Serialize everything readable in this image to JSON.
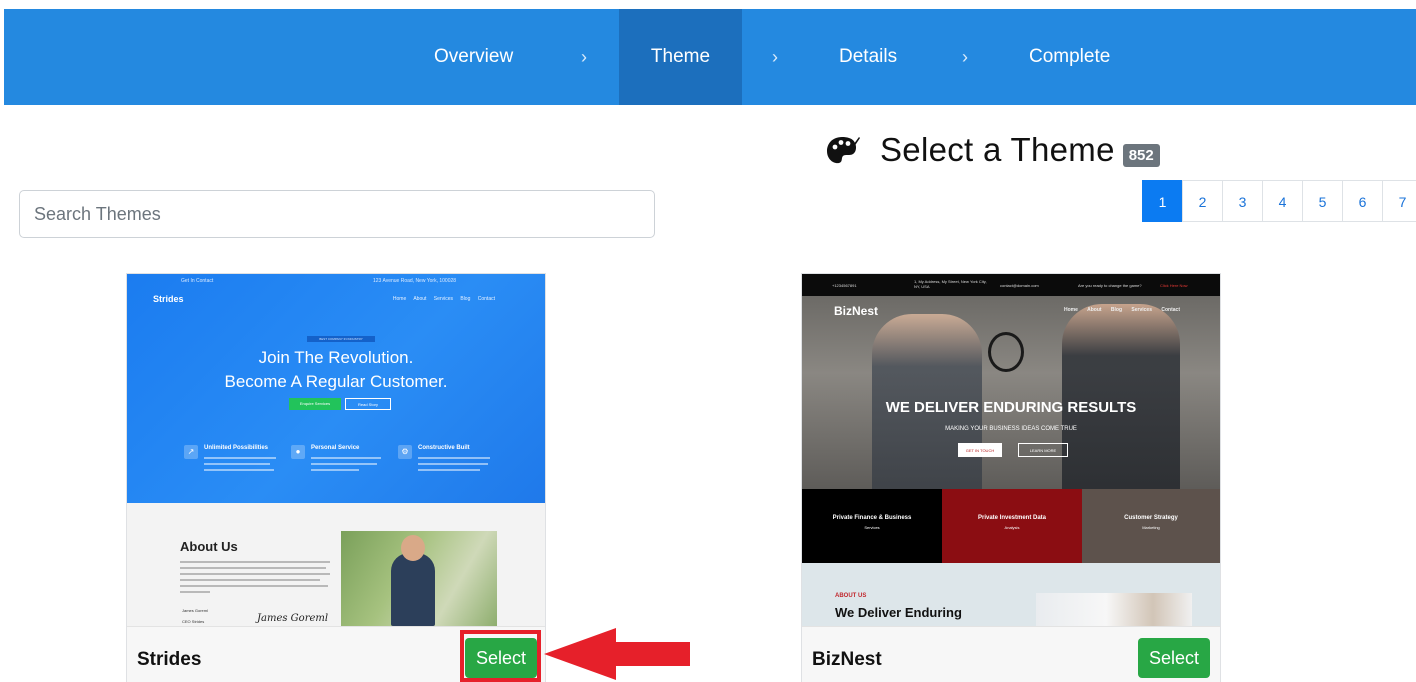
{
  "wizard": {
    "steps": [
      {
        "label": "Overview",
        "active": false
      },
      {
        "label": "Theme",
        "active": true
      },
      {
        "label": "Details",
        "active": false
      },
      {
        "label": "Complete",
        "active": false
      }
    ],
    "separator": "›",
    "colors": {
      "bar": "#2489e0",
      "active": "#1c6fbd"
    }
  },
  "heading": {
    "icon": "palette-icon",
    "title": "Select a Theme",
    "count": "852"
  },
  "search": {
    "placeholder": "Search Themes",
    "value": ""
  },
  "pagination": {
    "pages": [
      "1",
      "2",
      "3",
      "4",
      "5",
      "6",
      "7"
    ],
    "current": "1"
  },
  "themes": [
    {
      "name": "Strides",
      "select_label": "Select",
      "highlighted": true,
      "preview": {
        "topbar_left": "Get In Contact",
        "topbar_right": "123 Avenue Road, New York, 100028",
        "logo": "Strides",
        "nav": "Home About Services Blog Contact",
        "pill": "BEST COMPANY IN INDUSTRY",
        "headline_1": "Join The Revolution.",
        "headline_2": "Become A Regular Customer.",
        "btn_primary": "Enquire Services",
        "btn_secondary": "Read Story",
        "features": [
          "Unlimited Possibilities",
          "Personal Service",
          "Constructive Built"
        ],
        "about_heading": "About Us",
        "signature": "James Goreml",
        "signer_name": "James Goreml",
        "signer_role": "CEO Strides"
      }
    },
    {
      "name": "BizNest",
      "select_label": "Select",
      "highlighted": false,
      "preview": {
        "topbar_phone": "+1234567891",
        "topbar_address": "1, My Address, My Street, New York City, NY, USA",
        "topbar_email": "contact@domain.com",
        "topbar_prompt": "Are you ready to change the game?",
        "topbar_link": "Click Here Now",
        "logo": "BizNest",
        "nav": "Home About Blog Services Contact",
        "headline": "WE DELIVER  ENDURING RESULTS",
        "subheadline": "MAKING YOUR BUSINESS  IDEAS COME TRUE",
        "btn_primary": "GET IN TOUCH",
        "btn_secondary": "LEARN MORE",
        "bands": [
          {
            "title": "Private Finance & Business",
            "sub": "Services",
            "color": "#000000"
          },
          {
            "title": "Private Investment Data",
            "sub": "Analysis",
            "color": "#8b0d12"
          },
          {
            "title": "Customer Strategy",
            "sub": "Marketing",
            "color": "#5d524c"
          }
        ],
        "about_tag": "ABOUT US",
        "about_heading": "We Deliver Enduring"
      }
    }
  ],
  "annotation": {
    "color": "#e6202a",
    "target": "Strides select button"
  }
}
